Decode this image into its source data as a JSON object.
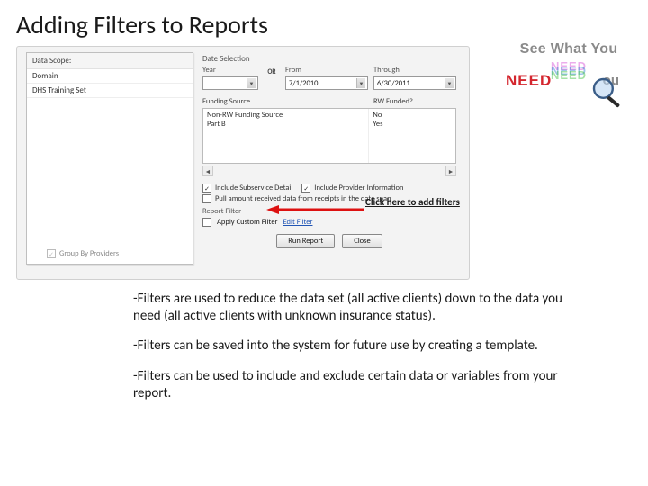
{
  "title": "Adding Filters to Reports",
  "logo": {
    "line1": "See What You",
    "need": "NEED",
    "you": "ou"
  },
  "window": {
    "scope_title": "Data Scope:",
    "scope_items": [
      "Domain",
      "DHS Training Set"
    ],
    "group_by": "Group By Providers",
    "select_title": "Date Selection",
    "year_label": "Year",
    "from_label": "From",
    "from_value": "7/1/2010",
    "through_label": "Through",
    "through_value": "6/30/2011",
    "or": "OR",
    "fund_h_left": "Funding Source",
    "fund_h_right": "RW Funded?",
    "fund_rows_left": [
      "Non-RW Funding Source",
      "Part B"
    ],
    "fund_rows_right": [
      "No",
      "Yes"
    ],
    "chk1": "Include Subservice Detail",
    "chk2": "Include Provider Information",
    "chk3": "Pull amount received data from receipts in the date span",
    "report_filter_title": "Report Filter",
    "apply_filter_label": "Apply Custom Filter",
    "edit_filter": "Edit Filter",
    "run_btn": "Run Report",
    "close_btn": "Close"
  },
  "arrow_label": "Click here to add filters",
  "body": {
    "p1": "-Filters are used to reduce the data set (all active clients) down to the data you need (all active clients with unknown insurance status).",
    "p2": "-Filters can be saved into the system for future use by creating a template.",
    "p3": "-Filters can be used to include and exclude certain data or variables from your report."
  }
}
